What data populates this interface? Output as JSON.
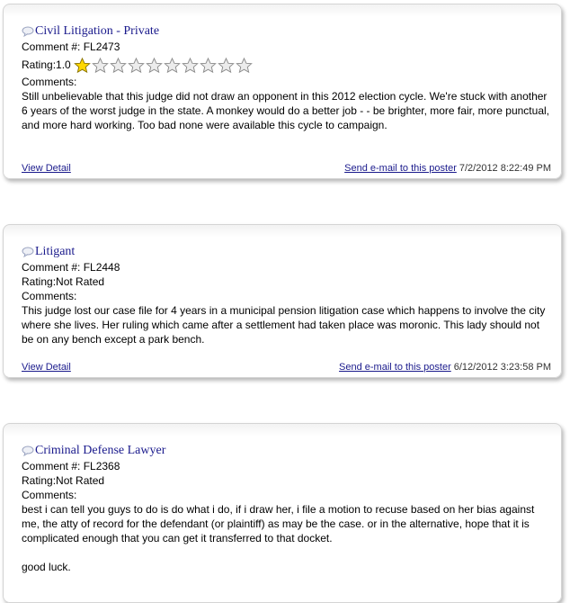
{
  "reviews": [
    {
      "title": "Civil Litigation - Private",
      "comment_label": "Comment #: ",
      "comment_id": "FL2473",
      "rating_label": "Rating:",
      "rating_value": "1.0",
      "stars_filled": 1,
      "stars_total": 10,
      "comments_label": "Comments:",
      "comment_paragraphs": [
        "Still unbelievable that this judge did not draw an opponent in this 2012 election cycle. We're stuck with another 6 years of the worst judge in the state. A monkey would do a better job - - be brighter, more fair, more punctual, and more hard working. Too bad none were available this cycle to campaign."
      ],
      "view_detail": "View Detail",
      "send_email": "Send e-mail to this poster",
      "date": "7/2/2012 8:22:49 PM"
    },
    {
      "title": "Litigant",
      "comment_label": "Comment #: ",
      "comment_id": "FL2448",
      "rating_label": "Rating:",
      "rating_value": "Not Rated",
      "comments_label": "Comments:",
      "comment_paragraphs": [
        "This judge lost our case file for 4 years in a municipal pension litigation case which happens to involve the city where she lives. Her ruling which came after a settlement had taken place was moronic. This lady should not be on any bench except a park bench."
      ],
      "view_detail": "View Detail",
      "send_email": "Send e-mail to this poster",
      "date": "6/12/2012 3:23:58 PM"
    },
    {
      "title": "Criminal Defense Lawyer",
      "comment_label": "Comment #: ",
      "comment_id": "FL2368",
      "rating_label": "Rating:",
      "rating_value": "Not Rated",
      "comments_label": "Comments:",
      "comment_paragraphs": [
        "best i can tell you guys to do is do what i do, if i draw her, i file a motion to recuse based on her bias against me, the atty of record for the defendant (or plaintiff) as may be the case. or in the alternative, hope that it is complicated enough that you can get it transferred to that docket.",
        "good luck."
      ]
    }
  ],
  "colors": {
    "title": "#1a1a8c",
    "link": "#1a1a8c",
    "star_filled": "#ffd700",
    "star_empty": "#c8c8c8"
  },
  "icons": {
    "title_icon": "speech-bubble-icon",
    "star": "star-icon"
  }
}
